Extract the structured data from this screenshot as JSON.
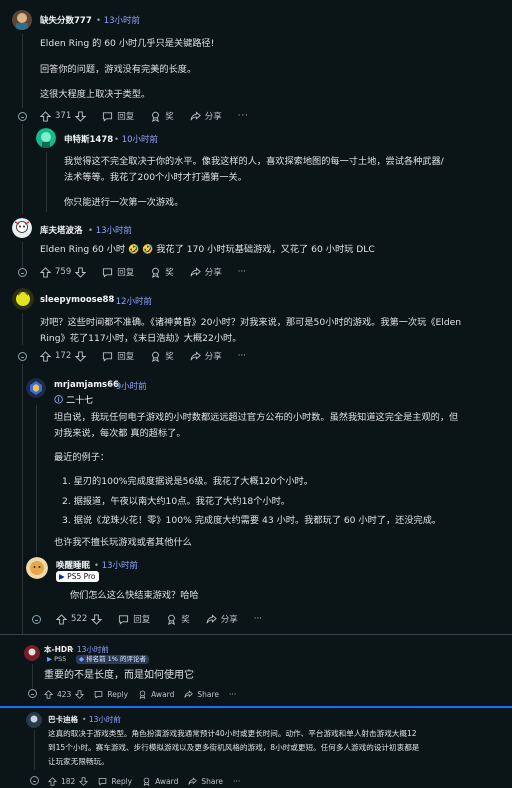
{
  "comments": [
    {
      "user": "缺失分数777",
      "time": "13小时前",
      "lines": [
        "Elden Ring 的 60 小时几乎只是关键路径!",
        "回答你的问题，游戏没有完美的长度。",
        "这很大程度上取决于类型。"
      ],
      "votes": "371",
      "reply": "回复",
      "award": "奖",
      "share": "分享"
    },
    {
      "user": "申特斯1478",
      "time": "10小时前",
      "lines": [
        "我觉得这不完全取决于你的水平。像我这样的人，喜欢探索地图的每一寸土地，尝试各种武器/",
        "法术等等。我花了200个小时才打通第一关。",
        "你只能进行一次第一次游戏。"
      ]
    },
    {
      "user": "库夫塔波洛",
      "time": "13小时前",
      "line_a": "Elden Ring 60 小时",
      "emoji": "🤣 🤣",
      "line_b": "我花了 170 小时玩基础游戏，又花了 60 小时玩 DLC",
      "votes": "759",
      "reply": "回复",
      "award": "奖",
      "share": "分享"
    },
    {
      "user": "sleepymoose88",
      "time": "12小时前",
      "lines": [
        "对吧？这些时间都不准确。《诸神黄昏》20小时？对我来说，那可是50小时的游戏。我第一次玩《Elden",
        "Ring》花了117小时，《末日浩劫》大概22小时。"
      ],
      "votes": "172",
      "reply": "回复",
      "award": "奖",
      "share": "分享"
    },
    {
      "user": "mrjamjams66",
      "time": "9小时前",
      "flair": "二十七",
      "lines": [
        "坦白说，我玩任何电子游戏的小时数都远远超过官方公布的小时数。虽然我知道这完全是主观的，但",
        "对我来说，每次都 真的超标了。"
      ],
      "intro": "最近的例子：",
      "list": [
        "星刃的100%完成度据说是56级。我花了大概120个小时。",
        "据报道，午夜以南大约10点。我花了大约18个小时。",
        "据说《龙珠火花！零》100% 完成度大约需要 43 小时。我都玩了 60 小时了，还没完成。"
      ],
      "outro": "也许我不擅长玩游戏或者其他什么"
    },
    {
      "user": "唤醒睡眠",
      "time": "13小时前",
      "flair": "PS5 Pro",
      "lines": [
        "你们怎么这么快结束游戏？哈哈"
      ],
      "votes": "522",
      "reply": "回复",
      "award": "奖",
      "share": "分享"
    },
    {
      "user": "本-HDR",
      "time": "13小时前",
      "flair_a": "PS5",
      "flair_b": "排名前 1% 的评论者",
      "lines": [
        "重要的不是长度，而是如何使用它"
      ],
      "votes": "423",
      "reply": "Reply",
      "award": "Award",
      "share": "Share"
    },
    {
      "user": "巴卡迪格",
      "time": "13小时前",
      "lines": [
        "这真的取决于游戏类型。角色扮演游戏我通常预计40小时或更长时间。动作、平台游戏和单人射击游戏大概12",
        "到15个小时。赛车游戏、步行模拟游戏以及更多街机风格的游戏，8小时或更短。任何多人游戏的设计初衷都是",
        "让玩家无限畅玩。"
      ],
      "votes": "182",
      "reply": "Reply",
      "award": "Award",
      "share": "Share"
    }
  ],
  "colors": {
    "background": "#0b1416",
    "time": "#8fa3ff",
    "divider_blue": "#1a6ef5"
  }
}
